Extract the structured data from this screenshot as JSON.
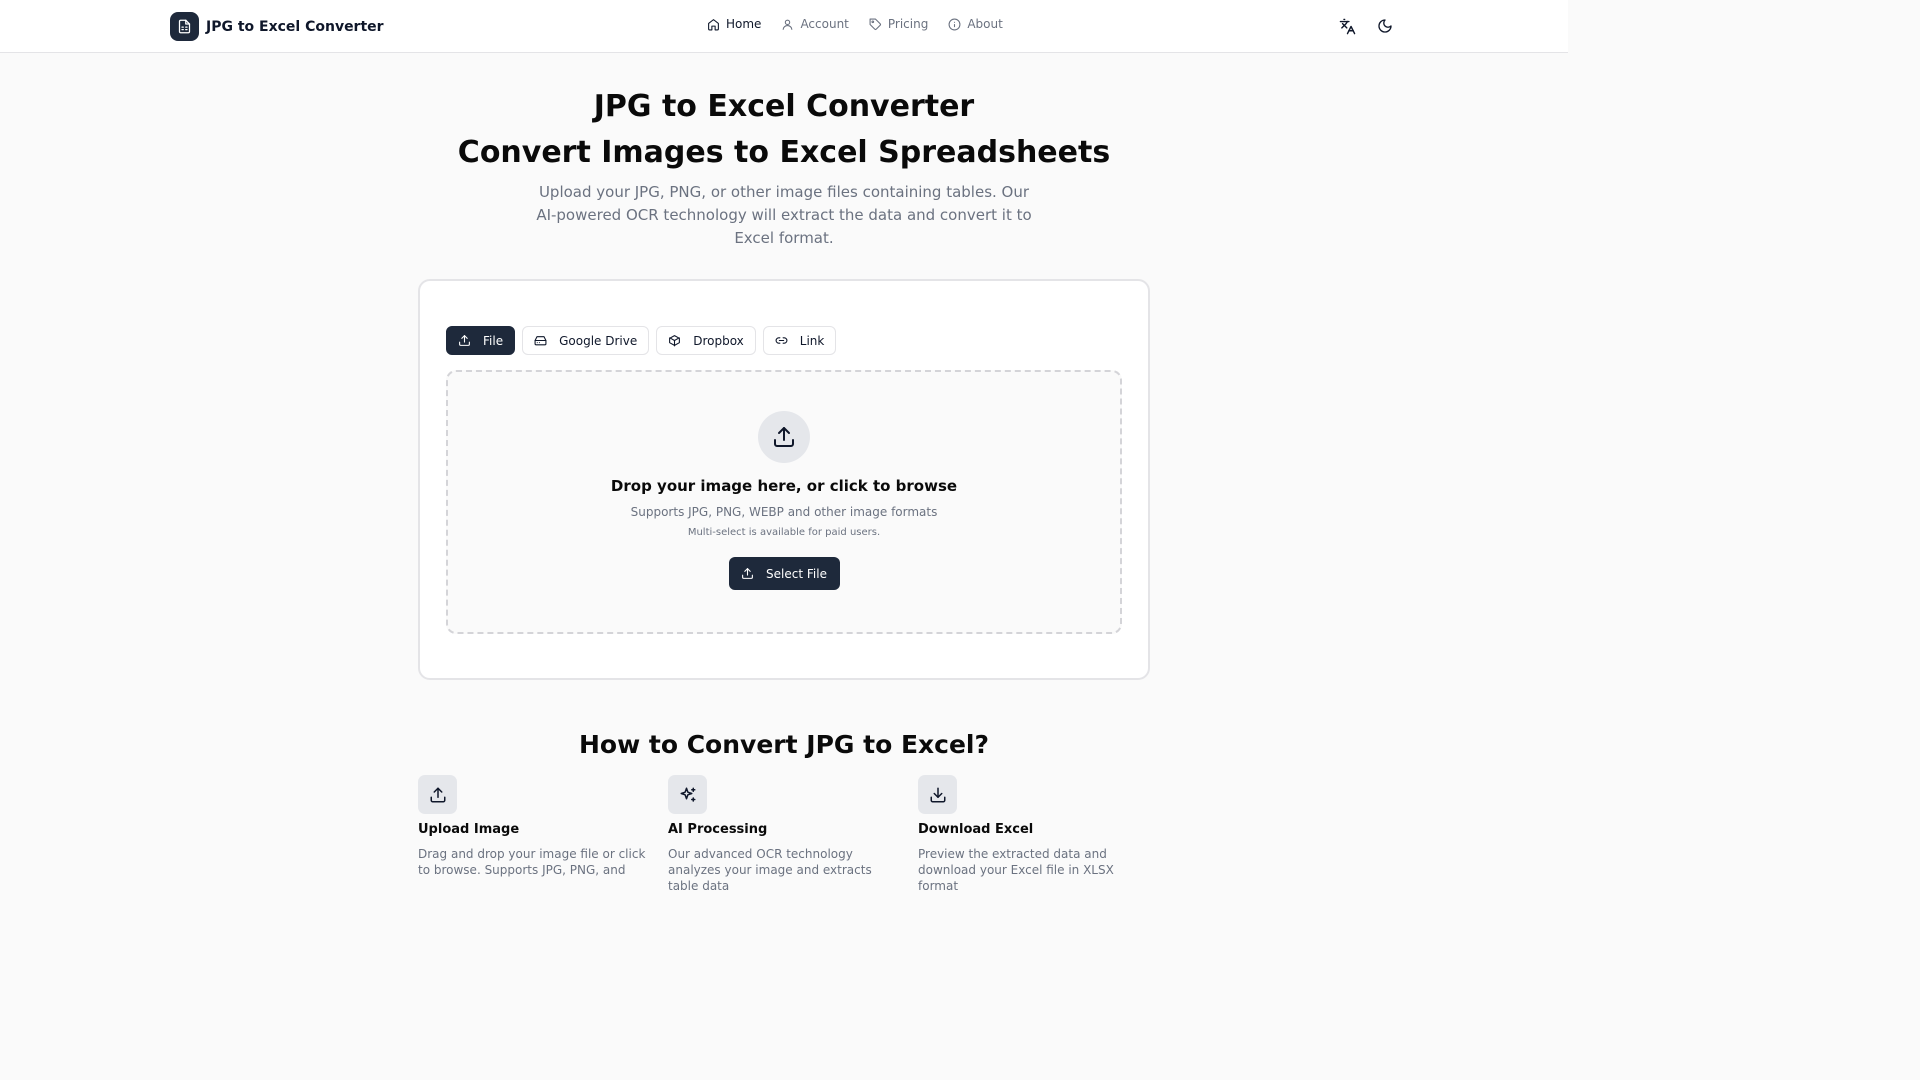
{
  "brand": {
    "name": "JPG to Excel Converter"
  },
  "nav": [
    {
      "label": "Home",
      "icon": "home-icon",
      "active": true
    },
    {
      "label": "Account",
      "icon": "user-icon"
    },
    {
      "label": "Pricing",
      "icon": "tag-icon"
    },
    {
      "label": "About",
      "icon": "info-icon"
    }
  ],
  "hero": {
    "title_line1": "JPG to Excel Converter",
    "title_line2": "Convert Images to Excel Spreadsheets",
    "description": "Upload your JPG, PNG, or other image files containing tables. Our AI-powered OCR technology will extract the data and convert it to Excel format."
  },
  "upload": {
    "tabs": [
      {
        "label": "File",
        "icon": "upload-icon",
        "active": true
      },
      {
        "label": "Google Drive",
        "icon": "drive-icon"
      },
      {
        "label": "Dropbox",
        "icon": "box-icon"
      },
      {
        "label": "Link",
        "icon": "link-icon"
      }
    ],
    "drop_title": "Drop your image here, or click to browse",
    "drop_subtitle": "Supports JPG, PNG, WEBP and other image formats",
    "drop_note": "Multi-select is available for paid users.",
    "select_button": "Select File"
  },
  "how": {
    "title": "How to Convert JPG to Excel?",
    "steps": [
      {
        "title": "Upload Image",
        "description": "Drag and drop your image file or click to browse. Supports JPG, PNG, and",
        "icon": "upload-icon"
      },
      {
        "title": "AI Processing",
        "description": "Our advanced OCR technology analyzes your image and extracts table data",
        "icon": "sparkles-icon"
      },
      {
        "title": "Download Excel",
        "description": "Preview the extracted data and download your Excel file in XLSX format",
        "icon": "download-icon"
      }
    ]
  },
  "colors": {
    "primary": "#1e293b",
    "muted_text": "#6b7280",
    "border": "#e4e4e7"
  }
}
